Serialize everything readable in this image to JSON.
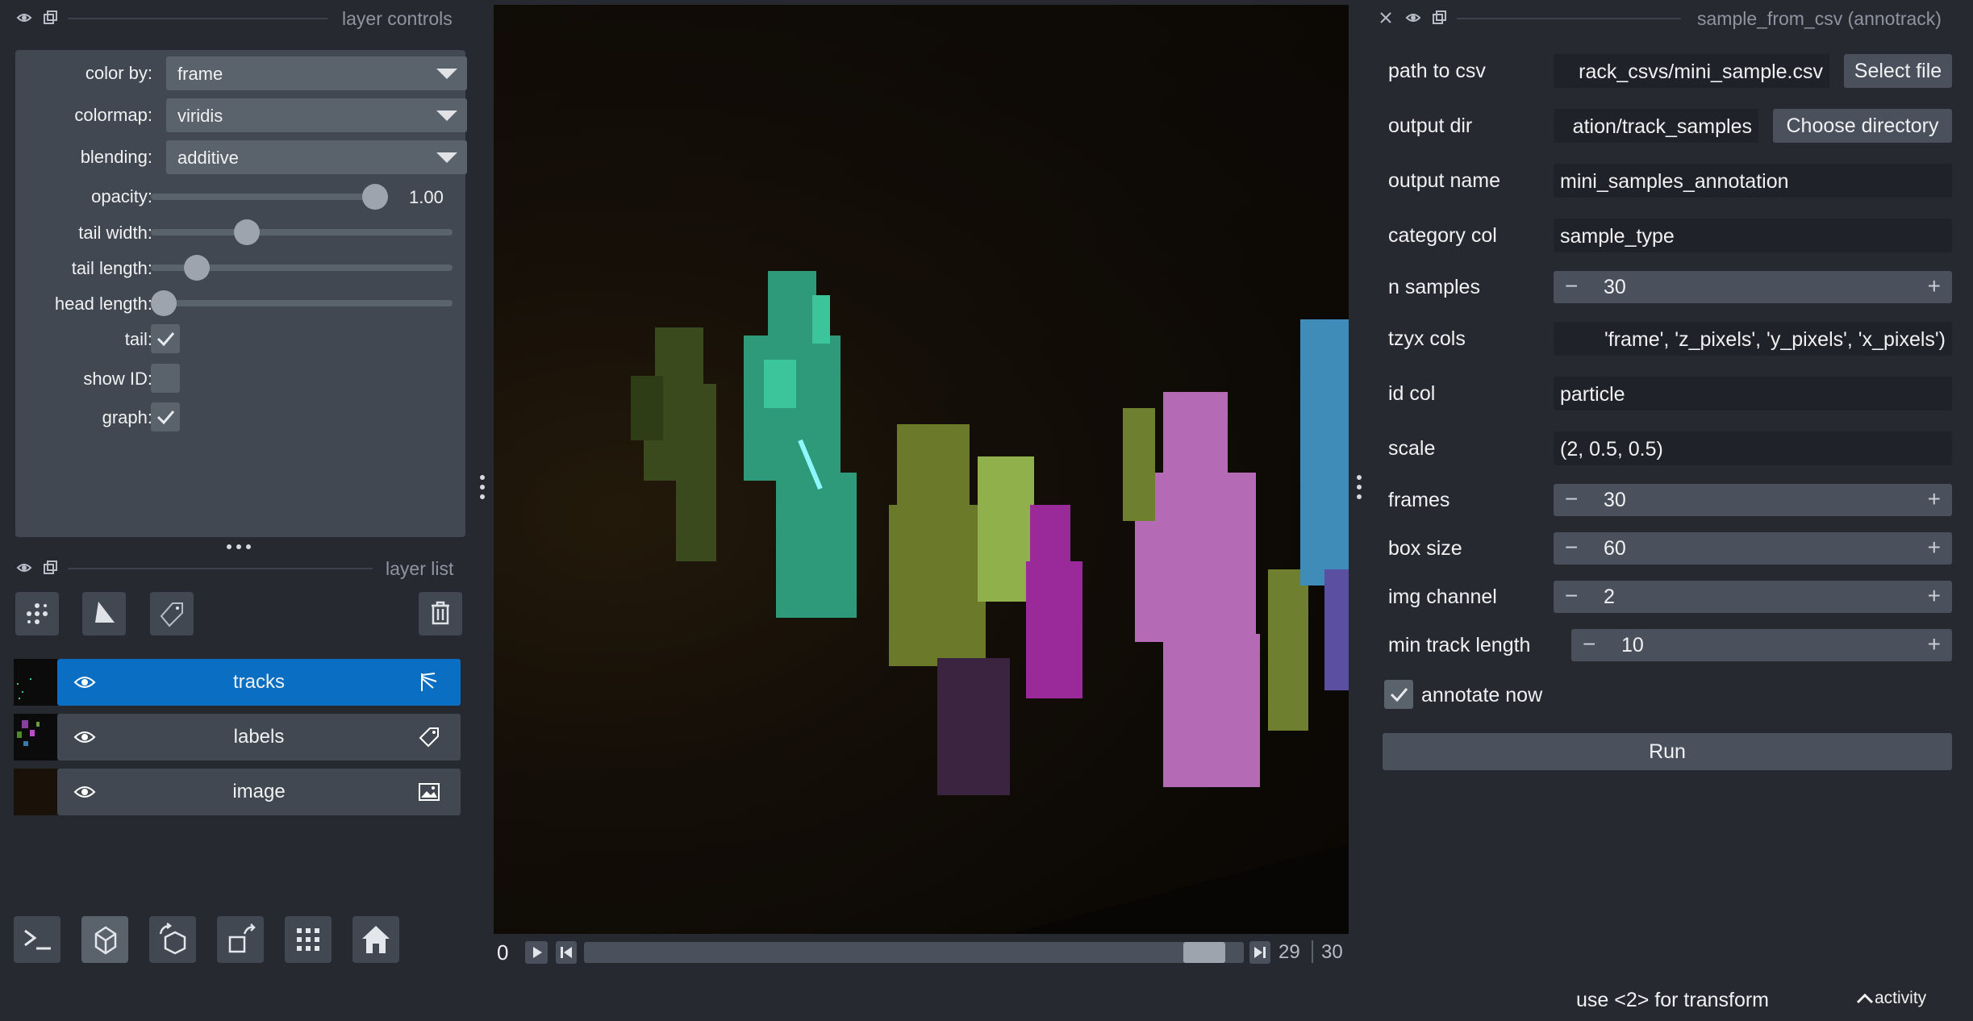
{
  "left_dock": {
    "title": "layer controls"
  },
  "layer_controls": {
    "color_by": {
      "label": "color by:",
      "value": "frame"
    },
    "colormap": {
      "label": "colormap:",
      "value": "viridis"
    },
    "blending": {
      "label": "blending:",
      "value": "additive"
    },
    "opacity": {
      "label": "opacity:",
      "value": "1.00",
      "fraction": 1.0
    },
    "tail_width": {
      "label": "tail width:",
      "fraction": 0.3
    },
    "tail_length": {
      "label": "tail length:",
      "fraction": 0.12
    },
    "head_length": {
      "label": "head length:",
      "fraction": 0.0
    },
    "tail": {
      "label": "tail:",
      "checked": true
    },
    "show_id": {
      "label": "show ID:",
      "checked": false
    },
    "graph": {
      "label": "graph:",
      "checked": true
    }
  },
  "layer_list": {
    "title": "layer list",
    "layers": [
      {
        "name": "tracks",
        "selected": true,
        "type_icon": "tracks-icon"
      },
      {
        "name": "labels",
        "selected": false,
        "type_icon": "label-tag-icon"
      },
      {
        "name": "image",
        "selected": false,
        "type_icon": "image-icon"
      }
    ]
  },
  "player": {
    "current_frame": "0",
    "end_frame": "29",
    "total_frames": "30",
    "position_fraction": 0.97
  },
  "widget": {
    "title": "sample_from_csv (annotrack)",
    "path_to_csv": {
      "label": "path to csv",
      "value": "rack_csvs/mini_sample.csv",
      "button": "Select file"
    },
    "output_dir": {
      "label": "output dir",
      "value": "ation/track_samples",
      "button": "Choose directory"
    },
    "output_name": {
      "label": "output name",
      "value": "mini_samples_annotation"
    },
    "category_col": {
      "label": "category col",
      "value": "sample_type"
    },
    "n_samples": {
      "label": "n samples",
      "value": "30"
    },
    "tzyx_cols": {
      "label": "tzyx cols",
      "value": "'frame', 'z_pixels', 'y_pixels', 'x_pixels')"
    },
    "id_col": {
      "label": "id col",
      "value": "particle"
    },
    "scale": {
      "label": "scale",
      "value": "(2, 0.5, 0.5)"
    },
    "frames": {
      "label": "frames",
      "value": "30"
    },
    "box_size": {
      "label": "box size",
      "value": "60"
    },
    "img_channel": {
      "label": "img channel",
      "value": "2"
    },
    "min_track_length": {
      "label": "min track length",
      "value": "10"
    },
    "annotate_now": {
      "label": "annotate now",
      "checked": true
    },
    "run_label": "Run"
  },
  "status": {
    "message": "use <2> for transform",
    "activity_label": "activity"
  },
  "colors": {
    "accent": "#0a6fc2",
    "background": "#262930",
    "panel": "#414851"
  }
}
